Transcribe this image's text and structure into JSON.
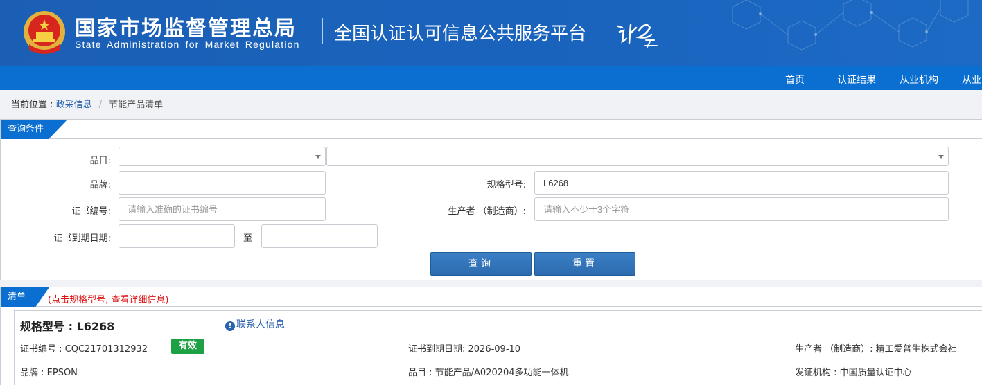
{
  "header": {
    "title_cn": "国家市场监督管理总局",
    "title_en": "State Administration for Market Regulation",
    "platform": "全国认证认可信息公共服务平台"
  },
  "nav": {
    "items": [
      "首页",
      "认证结果",
      "从业机构",
      "从业"
    ]
  },
  "breadcrumb": {
    "prefix": "当前位置 : ",
    "link": "政采信息",
    "sep": "/",
    "current": "节能产品清单"
  },
  "query": {
    "tab": "查询条件",
    "category_label": "品目:",
    "brand_label": "品牌:",
    "brand_value": "",
    "model_label": "规格型号:",
    "model_value": "L6268",
    "cert_no_label": "证书编号:",
    "cert_no_placeholder": "请输入准确的证书编号",
    "maker_label": "生产者 （制造商）:",
    "maker_placeholder": "请输入不少于3个字符",
    "expiry_label": "证书到期日期:",
    "to_label": "至",
    "search_button": "查询",
    "reset_button": "重置"
  },
  "list": {
    "tab": "清单",
    "note": "(点击规格型号, 查看详细信息)",
    "item": {
      "model": "规格型号 : L6268",
      "contact": "联系人信息",
      "cert_no": "证书编号 : CQC21701312932",
      "status": "有效",
      "expiry": "证书到期日期: 2026-09-10",
      "maker": "生产者 （制造商）: 精工爱普生株式会社",
      "brand": "品牌 : EPSON",
      "category": "品目 : 节能产品/A020204多功能一体机",
      "issuer": "发证机构 : 中国质量认证中心"
    }
  },
  "colors": {
    "header_blue": "#1b5fb5",
    "nav_blue": "#0a6fd0",
    "button_blue": "#2c6bb0",
    "valid_green": "#1ea044",
    "note_red": "#dd1111",
    "link_blue": "#2a62b0"
  },
  "icons": {
    "emblem": "national-emblem-icon",
    "contact": "info-circle-icon",
    "caret": "chevron-down-icon"
  }
}
